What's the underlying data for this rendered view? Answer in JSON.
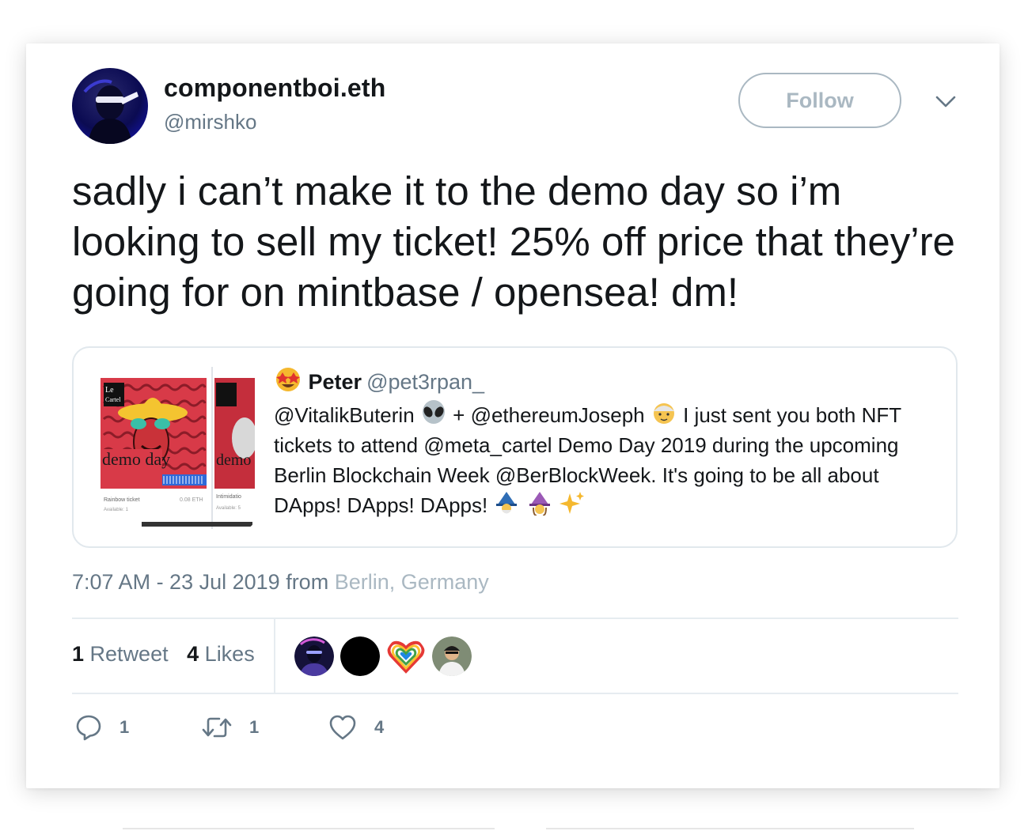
{
  "tweet": {
    "display_name": "componentboi.eth",
    "handle": "@mirshko",
    "follow_label": "Follow",
    "text": "sadly i can’t make it to the demo day so i’m looking to sell my ticket! 25% off price that they’re going for on mintbase / opensea! dm!",
    "timestamp": "7:07 AM - 23 Jul 2019",
    "from_word": "from",
    "location": "Berlin, Germany"
  },
  "quote": {
    "name": "Peter",
    "handle": "@pet3rpan_",
    "mention1": "@VitalikButerin",
    "plus": "+",
    "mention2": "@ethereumJoseph",
    "text_part1": "I just sent you both NFT tickets to attend @meta_cartel Demo Day 2019 during the upcoming Berlin Blockchain Week @BerBlockWeek. It's going to be all about DApps! DApps! DApps!",
    "emoji_names": [
      "star-struck-icon",
      "alien-icon",
      "old-man-icon",
      "man-mage-icon",
      "woman-mage-icon",
      "sparkles-icon"
    ],
    "media": {
      "logo_text_1": "Le",
      "logo_text_2": "Cartel",
      "title_text": "demo day",
      "ticket_label_1": "Rainbow ticket",
      "ticket_price_1": "0.08 ETH",
      "ticket_avail_1": "Available: 1",
      "ticket_label_2": "Intimidatio",
      "ticket_avail_2": "Available: 5"
    }
  },
  "stats": {
    "retweet_count": "1",
    "retweet_label": "Retweet",
    "like_count": "4",
    "like_label": "Likes"
  },
  "actions": {
    "reply_count": "1",
    "retweet_count": "1",
    "like_count": "4"
  },
  "colors": {
    "text": "#14171a",
    "secondary": "#657786",
    "light": "#aab8c2",
    "border": "#e1e8ed"
  }
}
